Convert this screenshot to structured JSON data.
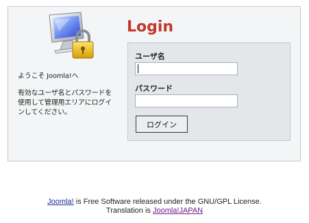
{
  "login": {
    "title": "Login",
    "username_label": "ユーザ名",
    "username_value": "",
    "password_label": "パスワード",
    "password_value": "",
    "submit_label": "ログイン"
  },
  "sidebar": {
    "welcome": "ようこそ Joomla!へ",
    "description": "有効なユーザ名とパスワードを使用して管理用エリアにログインしてください。",
    "icon": "computer-lock-icon"
  },
  "footer": {
    "joomla_link": "Joomla!",
    "license_text": " is Free Software released under the GNU/GPL License.",
    "translation_prefix": "Translation is ",
    "translation_link": "Joomla!JAPAN"
  },
  "colors": {
    "title": "#c0392b",
    "panel_bg": "#e4e7ea",
    "box_bg": "#f4f5f6",
    "link": "#1a2a9a",
    "visited_link": "#6b1a8c"
  }
}
